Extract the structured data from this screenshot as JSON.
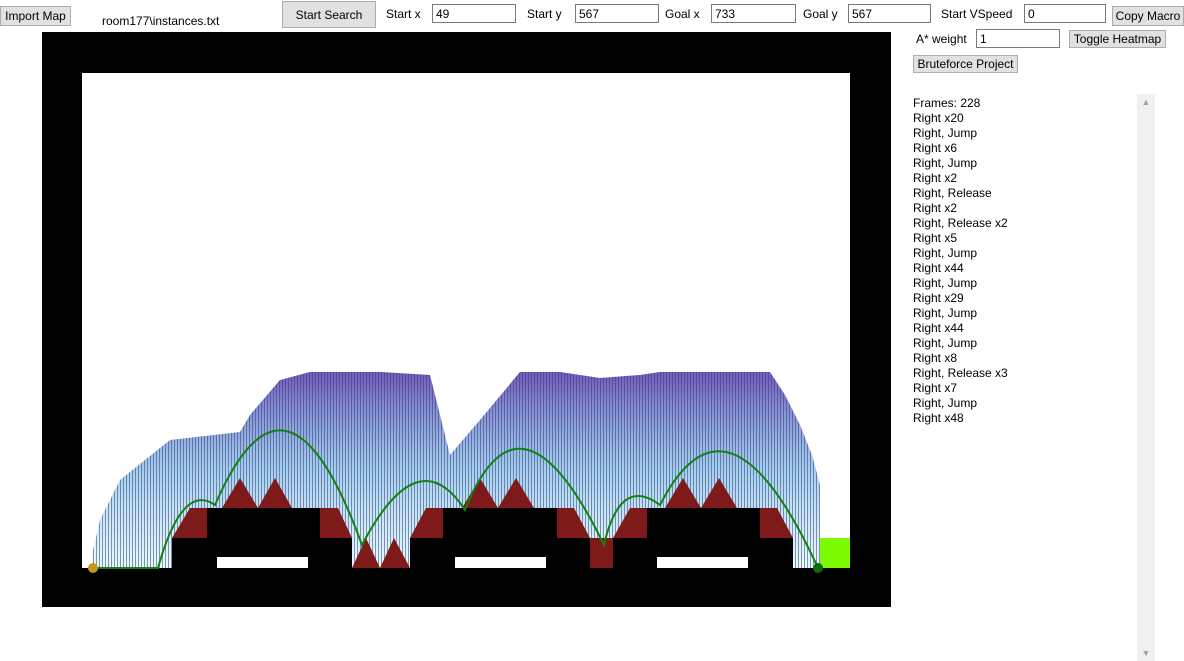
{
  "toolbar": {
    "import_map": "Import Map",
    "file_path": "room177\\instances.txt",
    "start_search": "Start Search",
    "start_x_label": "Start x",
    "start_x": "49",
    "start_y_label": "Start y",
    "start_y": "567",
    "goal_x_label": "Goal x",
    "goal_x": "733",
    "goal_y_label": "Goal y",
    "goal_y": "567",
    "start_vspeed_label": "Start VSpeed",
    "start_vspeed": "0",
    "copy_macro": "Copy Macro",
    "astar_weight_label": "A* weight",
    "astar_weight": "1",
    "toggle_heatmap": "Toggle Heatmap",
    "bruteforce_project": "Bruteforce Project"
  },
  "macro": {
    "lines": [
      "Frames: 228",
      "Right x20",
      "Right, Jump",
      "Right x6",
      "Right, Jump",
      "Right x2",
      "Right, Release",
      "Right x2",
      "Right, Release x2",
      "Right x5",
      "Right, Jump",
      "Right x44",
      "Right, Jump",
      "Right x29",
      "Right, Jump",
      "Right x44",
      "Right, Jump",
      "Right x8",
      "Right, Release x3",
      "Right x7",
      "Right, Jump",
      "Right x48"
    ]
  },
  "map": {
    "colors": {
      "wall": "#000000",
      "spike": "#7e1a1a",
      "goal_zone": "#7cfc00",
      "path": "#138013",
      "start_marker": "#c8961e",
      "goal_marker": "#0c6a0c"
    }
  },
  "scrollbar": {
    "up_icon": "▲",
    "down_icon": "▼"
  }
}
